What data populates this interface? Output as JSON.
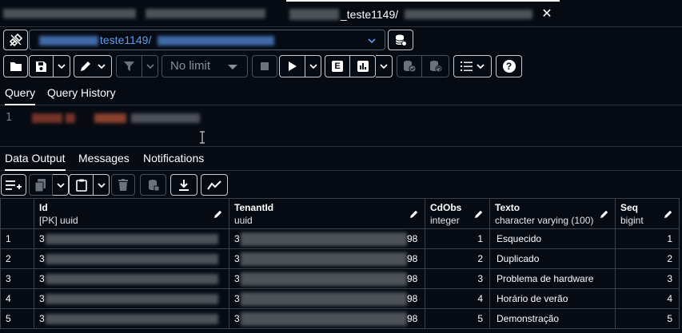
{
  "tabs": {
    "active_label": "_teste1149/",
    "close_glyph": "✕"
  },
  "connection": {
    "value": "teste1149/"
  },
  "toolbar": {
    "limit_value": "No limit",
    "help_glyph": "?",
    "explain_glyph": "E"
  },
  "query_tabs": [
    "Query",
    "Query History"
  ],
  "editor": {
    "line_number": "1"
  },
  "output_tabs": [
    "Data Output",
    "Messages",
    "Notifications"
  ],
  "grid": {
    "columns": [
      {
        "name": "Id",
        "type": "[PK] uuid"
      },
      {
        "name": "TenantId",
        "type": "uuid"
      },
      {
        "name": "CdObs",
        "type": "integer"
      },
      {
        "name": "Texto",
        "type": "character varying (100)"
      },
      {
        "name": "Seq",
        "type": "bigint"
      }
    ],
    "rows": [
      {
        "rownum": "1",
        "id_prefix": "3",
        "tenant_prefix": "3",
        "tenant_suffix": "98",
        "cdobs": "1",
        "texto": "Esquecido",
        "seq": "1"
      },
      {
        "rownum": "2",
        "id_prefix": "3",
        "tenant_prefix": "3",
        "tenant_suffix": "98",
        "cdobs": "2",
        "texto": "Duplicado",
        "seq": "2"
      },
      {
        "rownum": "3",
        "id_prefix": "3",
        "tenant_prefix": "3",
        "tenant_suffix": "98",
        "cdobs": "3",
        "texto": "Problema de hardware",
        "seq": "3"
      },
      {
        "rownum": "4",
        "id_prefix": "3",
        "tenant_prefix": "3",
        "tenant_suffix": "98",
        "cdobs": "4",
        "texto": "Horário de verão",
        "seq": "4"
      },
      {
        "rownum": "5",
        "id_prefix": "3",
        "tenant_prefix": "3",
        "tenant_suffix": "98",
        "cdobs": "5",
        "texto": "Demonstração",
        "seq": "5"
      }
    ]
  },
  "colors": {
    "background": "#050a13",
    "accent_link": "#5aa0f2",
    "border": "#c8ccd2",
    "disabled_border": "#4a4f58"
  }
}
